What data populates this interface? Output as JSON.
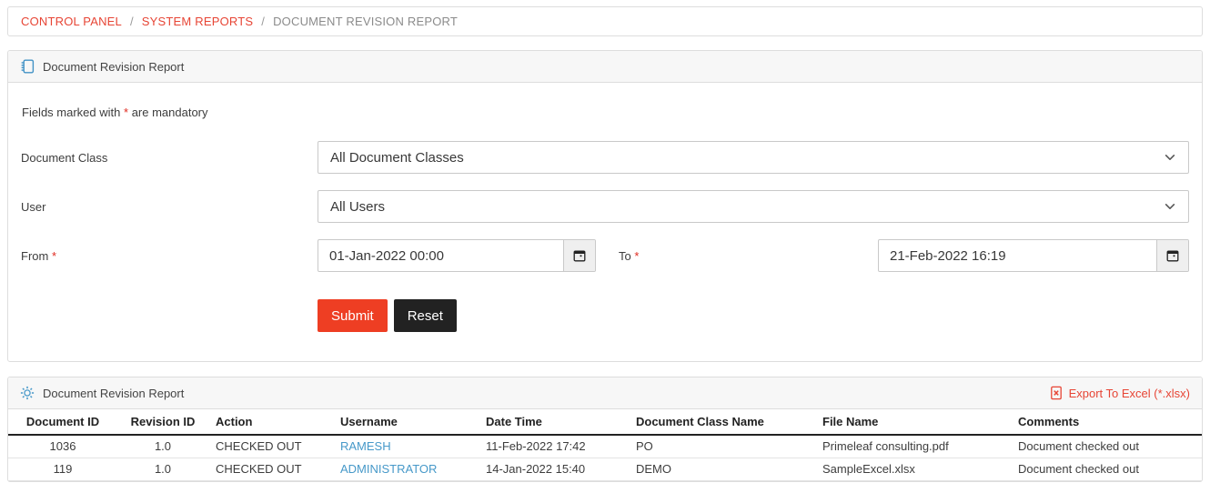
{
  "colors": {
    "accent_red": "#e74535",
    "link_blue": "#4799c9",
    "submit_bg": "#ee3e23",
    "reset_bg": "#222222",
    "panel_head_bg": "#f7f7f7"
  },
  "breadcrumb": {
    "separator": "/",
    "items": [
      {
        "label": "CONTROL PANEL"
      },
      {
        "label": "SYSTEM REPORTS"
      },
      {
        "label": "DOCUMENT REVISION REPORT"
      }
    ]
  },
  "report_form": {
    "title": "Document Revision Report",
    "icon": "journal-icon",
    "note": {
      "prefix": "Fields marked with",
      "star": "*",
      "suffix": "are mandatory"
    },
    "fields": {
      "document_class": {
        "label": "Document Class",
        "value": "All Document Classes"
      },
      "user": {
        "label": "User",
        "value": "All Users"
      },
      "from": {
        "label": "From",
        "star": "*",
        "value": "01-Jan-2022 00:00"
      },
      "to": {
        "label": "To",
        "star": "*",
        "value": "21-Feb-2022 16:19"
      }
    },
    "buttons": {
      "submit": "Submit",
      "reset": "Reset"
    }
  },
  "results": {
    "title": "Document Revision Report",
    "icon": "gear-icon",
    "export_label": "Export To Excel (*.xlsx)",
    "table": {
      "columns": [
        "Document ID",
        "Revision ID",
        "Action",
        "Username",
        "Date Time",
        "Document Class Name",
        "File Name",
        "Comments"
      ],
      "rows": [
        [
          "1036",
          "1.0",
          "CHECKED OUT",
          "RAMESH",
          "11-Feb-2022 17:42",
          "PO",
          "Primeleaf consulting.pdf",
          "Document checked out"
        ],
        [
          "119",
          "1.0",
          "CHECKED OUT",
          "ADMINISTRATOR",
          "14-Jan-2022 15:40",
          "DEMO",
          "SampleExcel.xlsx",
          "Document checked out"
        ]
      ]
    }
  }
}
